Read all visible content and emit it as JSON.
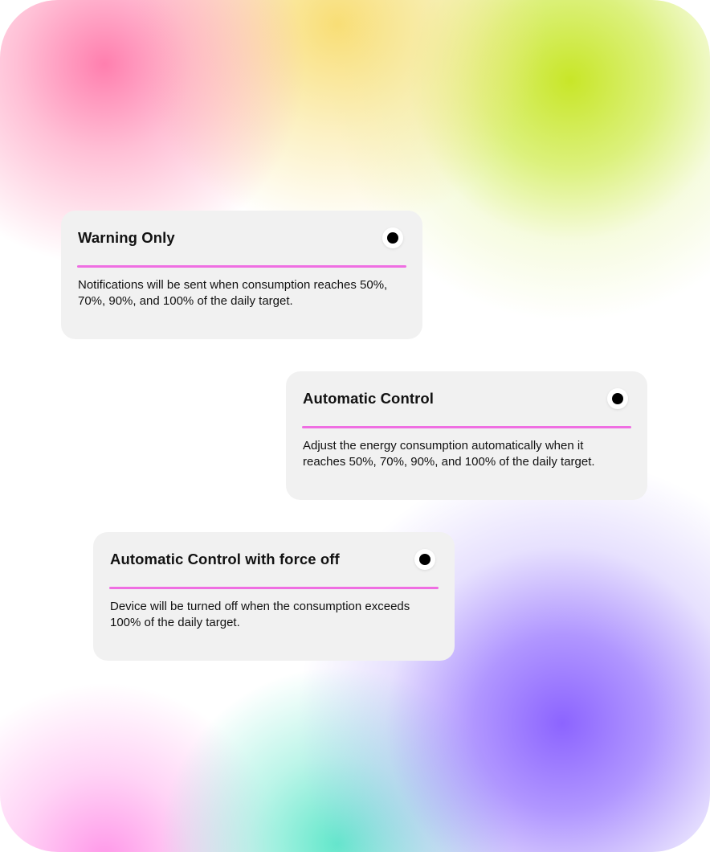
{
  "options": [
    {
      "title": "Warning Only",
      "description": "Notifications will be sent when consumption reaches 50%, 70%, 90%, and 100% of the daily target."
    },
    {
      "title": "Automatic Control",
      "description": "Adjust the energy consumption automatically when it reaches 50%, 70%, 90%, and 100% of the daily target."
    },
    {
      "title": "Automatic Control with force off",
      "description": "Device will be turned off when the consumption exceeds 100% of the daily target."
    }
  ],
  "colors": {
    "card_background": "#f1f1f1",
    "divider_accent": "#ef6ee2",
    "radio_dot": "#000000",
    "radio_ring": "#ffffff"
  },
  "icons": {
    "radio": "radio-button-icon"
  }
}
